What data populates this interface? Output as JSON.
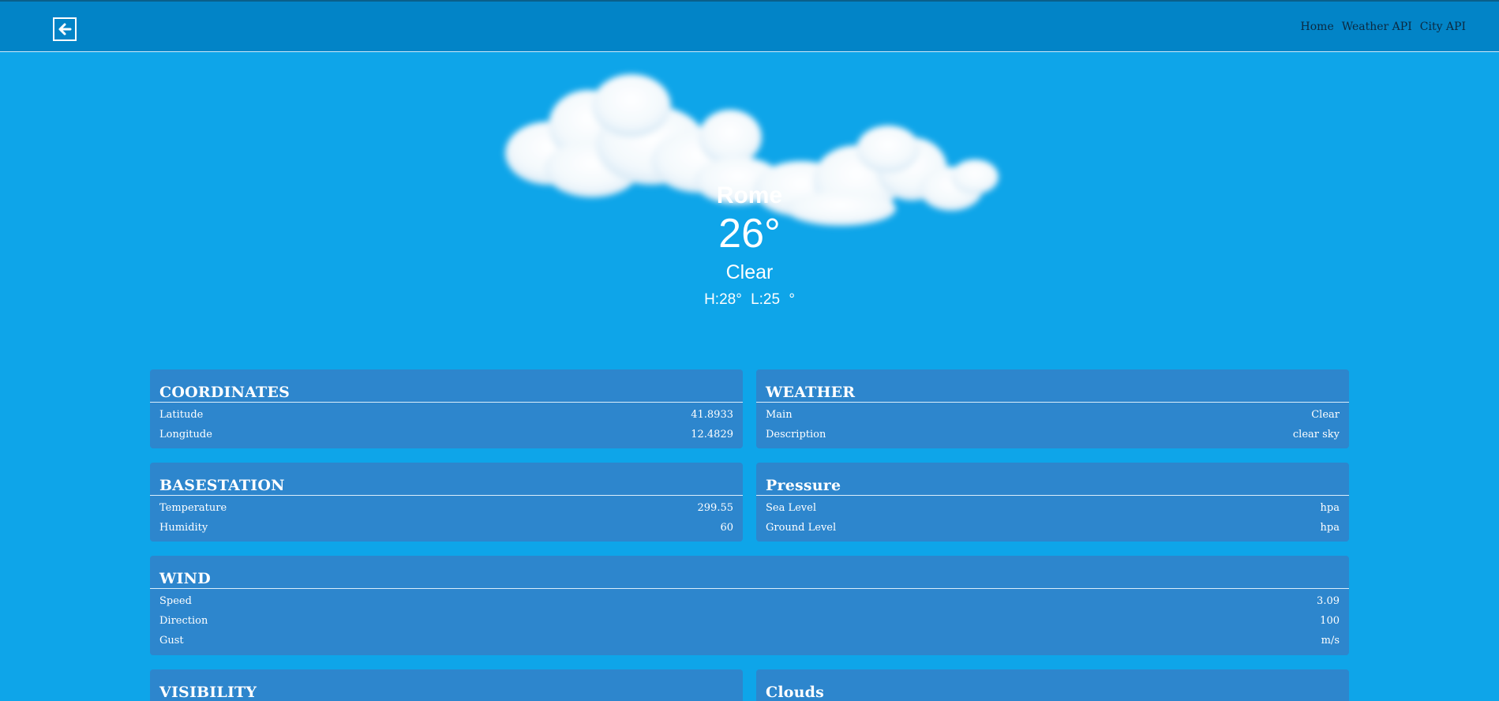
{
  "nav": {
    "links": [
      "Home",
      "Weather API",
      "City API"
    ]
  },
  "hero": {
    "city": "Rome",
    "temperature": "26°",
    "condition": "Clear",
    "high_low": "H:28°  L:25 °"
  },
  "cards": {
    "coordinates": {
      "title": "COORDINATES",
      "rows": [
        {
          "label": "Latitude",
          "value": "41.8933"
        },
        {
          "label": "Longitude",
          "value": "12.4829"
        }
      ]
    },
    "weather": {
      "title": "WEATHER",
      "rows": [
        {
          "label": "Main",
          "value": "Clear"
        },
        {
          "label": "Description",
          "value": "clear sky"
        }
      ]
    },
    "basestation": {
      "title": "BASESTATION",
      "rows": [
        {
          "label": "Temperature",
          "value": "299.55"
        },
        {
          "label": "Humidity",
          "value": "60"
        }
      ]
    },
    "pressure": {
      "title": "Pressure",
      "rows": [
        {
          "label": "Sea Level",
          "value": "hpa"
        },
        {
          "label": "Ground Level",
          "value": "hpa"
        }
      ]
    },
    "wind": {
      "title": "WIND",
      "rows": [
        {
          "label": "Speed",
          "value": "3.09"
        },
        {
          "label": "Direction",
          "value": "100"
        },
        {
          "label": "Gust",
          "value": "m/s"
        }
      ]
    },
    "visibility": {
      "title": "VISIBILITY"
    },
    "clouds": {
      "title": "Clouds"
    }
  },
  "icons": {
    "back": "arrow-left-icon",
    "weather": "clouds-icon"
  },
  "colors": {
    "background": "#0ea5e9",
    "navbar": "#0284c7",
    "card": "#2d86cd"
  }
}
